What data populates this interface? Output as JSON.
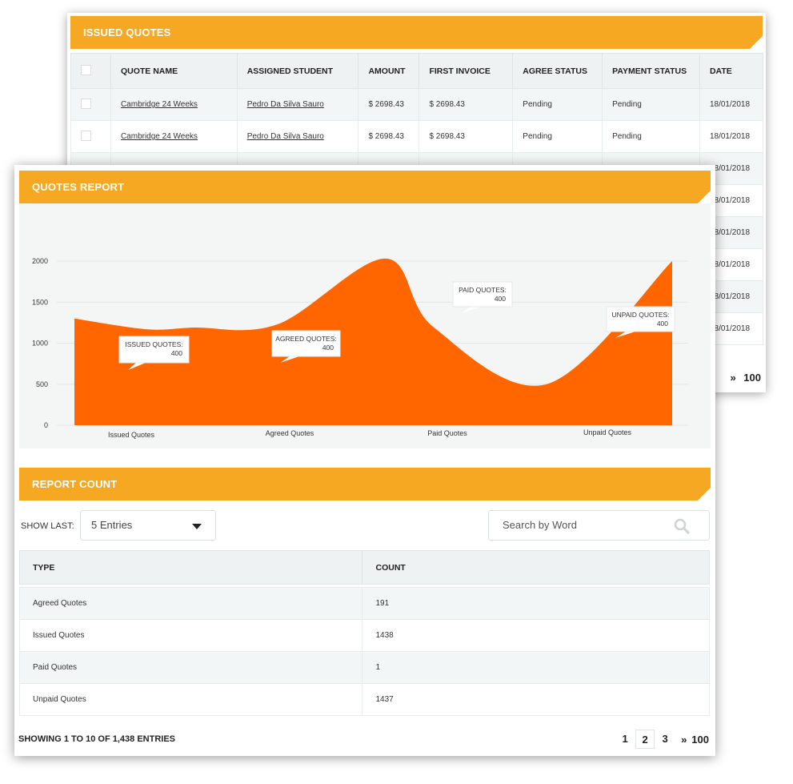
{
  "issued_quotes": {
    "title": "ISSUED QUOTES",
    "columns": [
      "QUOTE NAME",
      "ASSIGNED STUDENT",
      "AMOUNT",
      "FIRST INVOICE",
      "AGREE STATUS",
      "PAYMENT STATUS",
      "DATE"
    ],
    "rows": [
      {
        "quote_name": "Cambridge 24 Weeks",
        "student": "Pedro Da Silva Sauro",
        "amount": "$ 2698.43",
        "first_invoice": "$ 2698.43",
        "agree_status": "Pending",
        "payment_status": "Pending",
        "date": "18/01/2018"
      },
      {
        "quote_name": "Cambridge 24 Weeks",
        "student": "Pedro Da Silva Sauro",
        "amount": "$ 2698.43",
        "first_invoice": "$ 2698.43",
        "agree_status": "Pending",
        "payment_status": "Pending",
        "date": "18/01/2018"
      },
      {
        "quote_name": "",
        "student": "",
        "amount": "",
        "first_invoice": "",
        "agree_status": "",
        "payment_status": "",
        "date": "18/01/2018"
      },
      {
        "quote_name": "",
        "student": "",
        "amount": "",
        "first_invoice": "",
        "agree_status": "",
        "payment_status": "",
        "date": "18/01/2018"
      },
      {
        "quote_name": "",
        "student": "",
        "amount": "",
        "first_invoice": "",
        "agree_status": "",
        "payment_status": "",
        "date": "18/01/2018"
      },
      {
        "quote_name": "",
        "student": "",
        "amount": "",
        "first_invoice": "",
        "agree_status": "",
        "payment_status": "",
        "date": "18/01/2018"
      },
      {
        "quote_name": "",
        "student": "",
        "amount": "",
        "first_invoice": "",
        "agree_status": "",
        "payment_status": "",
        "date": "18/01/2018"
      },
      {
        "quote_name": "",
        "student": "",
        "amount": "",
        "first_invoice": "",
        "agree_status": "",
        "payment_status": "",
        "date": "18/01/2018"
      }
    ],
    "pager_last": "100"
  },
  "quotes_report": {
    "title": "QUOTES REPORT"
  },
  "chart_data": {
    "type": "area",
    "title": "QUOTES REPORT",
    "categories": [
      "Issued Quotes",
      "Agreed Quotes",
      "Paid Quotes",
      "Unpaid Quotes"
    ],
    "y_ticks": [
      0,
      500,
      1000,
      1500,
      2000
    ],
    "ylim": [
      0,
      2000
    ],
    "curve": {
      "x": [
        0,
        0.12,
        0.2,
        0.34,
        0.52,
        0.6,
        0.79,
        1.0
      ],
      "y": [
        1300,
        1170,
        1190,
        1230,
        2030,
        1200,
        500,
        2000
      ]
    },
    "tooltips": [
      {
        "label": "ISSUED QUOTES:",
        "value": "400",
        "category": "Issued Quotes"
      },
      {
        "label": "AGREED QUOTES:",
        "value": "400",
        "category": "Agreed Quotes"
      },
      {
        "label": "PAID QUOTES:",
        "value": "400",
        "category": "Paid Quotes"
      },
      {
        "label": "UNPAID QUOTES:",
        "value": "400",
        "category": "Unpaid Quotes"
      }
    ],
    "grid": true,
    "fill_color": "#ff6600"
  },
  "report_count": {
    "title": "REPORT COUNT",
    "show_last_label": "SHOW LAST:",
    "entries_selected": "5 Entries",
    "search_placeholder": "Search by Word",
    "columns": [
      "TYPE",
      "COUNT"
    ],
    "rows": [
      {
        "type": "Agreed Quotes",
        "count": "191"
      },
      {
        "type": "Issued Quotes",
        "count": "1438"
      },
      {
        "type": "Paid Quotes",
        "count": "1"
      },
      {
        "type": "Unpaid Quotes",
        "count": "1437"
      }
    ],
    "entries_info": "SHOWING 1 TO 10 OF 1,438 ENTRIES",
    "pages": [
      "1",
      "2",
      "3"
    ],
    "active_page": "2",
    "pager_last": "100"
  },
  "colors": {
    "header_orange": "#f7a823",
    "chart_orange": "#ff6600",
    "table_header_bg": "#eef2f2"
  }
}
